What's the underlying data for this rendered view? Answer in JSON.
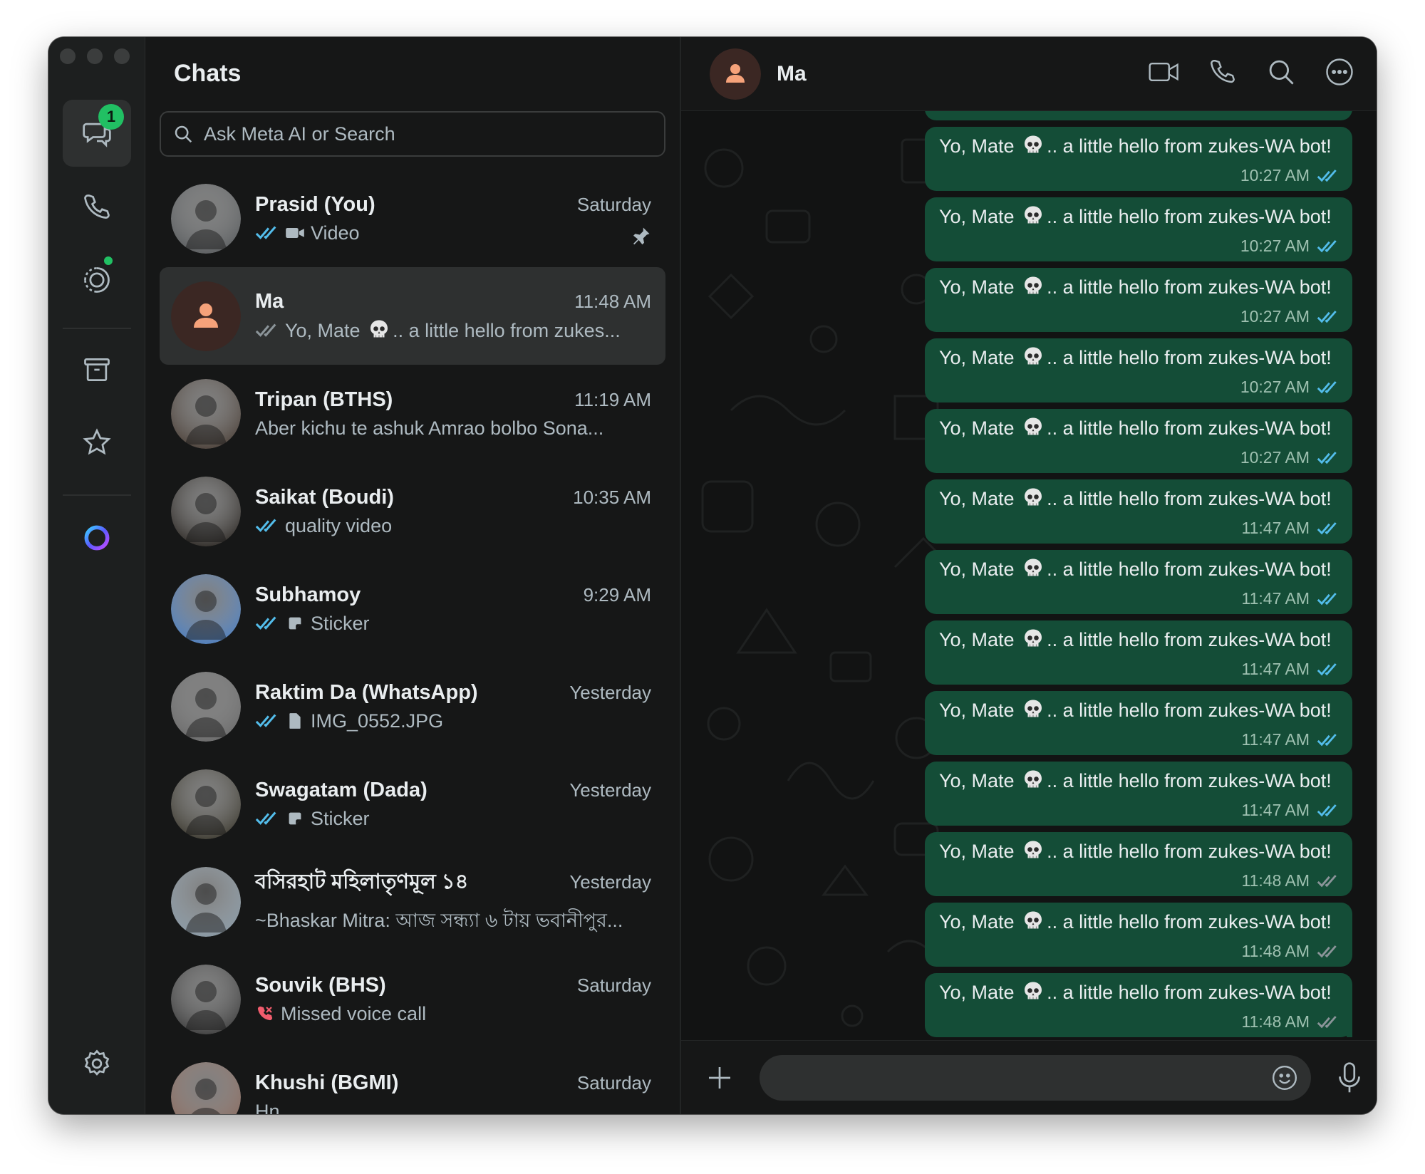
{
  "sidebar": {
    "chats_badge": "1"
  },
  "chat_list": {
    "title": "Chats",
    "search_placeholder": "Ask Meta AI or Search",
    "items": [
      {
        "name": "Prasid (You)",
        "time": "Saturday",
        "preview": "Video",
        "status": "read",
        "type": "video",
        "pinned": true,
        "avatar_color": "#5a5d5f"
      },
      {
        "name": "Ma",
        "time": "11:48 AM",
        "preview": "Yo, Mate 💀.. a little hello from zukes...",
        "status": "delivered",
        "type": "text",
        "selected": true,
        "avatar_color": "#3b2723"
      },
      {
        "name": "Tripan (BTHS)",
        "time": "11:19 AM",
        "preview": "Aber kichu te ashuk  Amrao bolbo Sona...",
        "status": "none",
        "type": "text",
        "avatar_color": "#4b4038"
      },
      {
        "name": "Saikat (Boudi)",
        "time": "10:35 AM",
        "preview": "quality video",
        "status": "read",
        "type": "text",
        "avatar_color": "#2e2a26"
      },
      {
        "name": "Subhamoy",
        "time": "9:29 AM",
        "preview": "Sticker",
        "status": "read",
        "type": "sticker",
        "avatar_color": "#4d7fc0"
      },
      {
        "name": "Raktim Da (WhatsApp)",
        "time": "Yesterday",
        "preview": "IMG_0552.JPG",
        "status": "read",
        "type": "document",
        "avatar_color": "#6a6a6a"
      },
      {
        "name": "Swagatam (Dada)",
        "time": "Yesterday",
        "preview": "Sticker",
        "status": "read",
        "type": "sticker",
        "avatar_color": "#3d3a30"
      },
      {
        "name": "বসিরহাট মহিলাতৃণমূল ১৪",
        "time": "Yesterday",
        "preview": "~Bhaskar Mitra: আজ সন্ধ্যা ৬ টায় ভবানীপুর...",
        "status": "none",
        "type": "text",
        "avatar_color": "#8a9aa6"
      },
      {
        "name": "Souvik (BHS)",
        "time": "Saturday",
        "preview": "Missed voice call",
        "status": "none",
        "type": "missed-call",
        "avatar_color": "#3e3e3e"
      },
      {
        "name": "Khushi (BGMI)",
        "time": "Saturday",
        "preview": "Hn",
        "status": "none",
        "type": "text",
        "avatar_color": "#8a6a5e"
      }
    ]
  },
  "conversation": {
    "contact_name": "Ma",
    "composer_placeholder": "",
    "messages": [
      {
        "text": "Yo, Mate 💀.. a little hello from zukes-WA bot!",
        "time": "10:27 AM",
        "status": "read"
      },
      {
        "text": "Yo, Mate 💀.. a little hello from zukes-WA bot!",
        "time": "10:27 AM",
        "status": "read"
      },
      {
        "text": "Yo, Mate 💀.. a little hello from zukes-WA bot!",
        "time": "10:27 AM",
        "status": "read"
      },
      {
        "text": "Yo, Mate 💀.. a little hello from zukes-WA bot!",
        "time": "10:27 AM",
        "status": "read"
      },
      {
        "text": "Yo, Mate 💀.. a little hello from zukes-WA bot!",
        "time": "10:27 AM",
        "status": "read"
      },
      {
        "text": "Yo, Mate 💀.. a little hello from zukes-WA bot!",
        "time": "11:47 AM",
        "status": "read"
      },
      {
        "text": "Yo, Mate 💀.. a little hello from zukes-WA bot!",
        "time": "11:47 AM",
        "status": "read"
      },
      {
        "text": "Yo, Mate 💀.. a little hello from zukes-WA bot!",
        "time": "11:47 AM",
        "status": "read"
      },
      {
        "text": "Yo, Mate 💀.. a little hello from zukes-WA bot!",
        "time": "11:47 AM",
        "status": "read"
      },
      {
        "text": "Yo, Mate 💀.. a little hello from zukes-WA bot!",
        "time": "11:47 AM",
        "status": "read"
      },
      {
        "text": "Yo, Mate 💀.. a little hello from zukes-WA bot!",
        "time": "11:48 AM",
        "status": "delivered"
      },
      {
        "text": "Yo, Mate 💀.. a little hello from zukes-WA bot!",
        "time": "11:48 AM",
        "status": "delivered"
      },
      {
        "text": "Yo, Mate 💀.. a little hello from zukes-WA bot!",
        "time": "11:48 AM",
        "status": "delivered"
      }
    ]
  },
  "colors": {
    "accent": "#21c063",
    "bubble_out": "#144d37",
    "read_tick": "#53bdeb",
    "missed_call": "#f15c6d",
    "ma_avatar_icon": "#f6a27a"
  }
}
